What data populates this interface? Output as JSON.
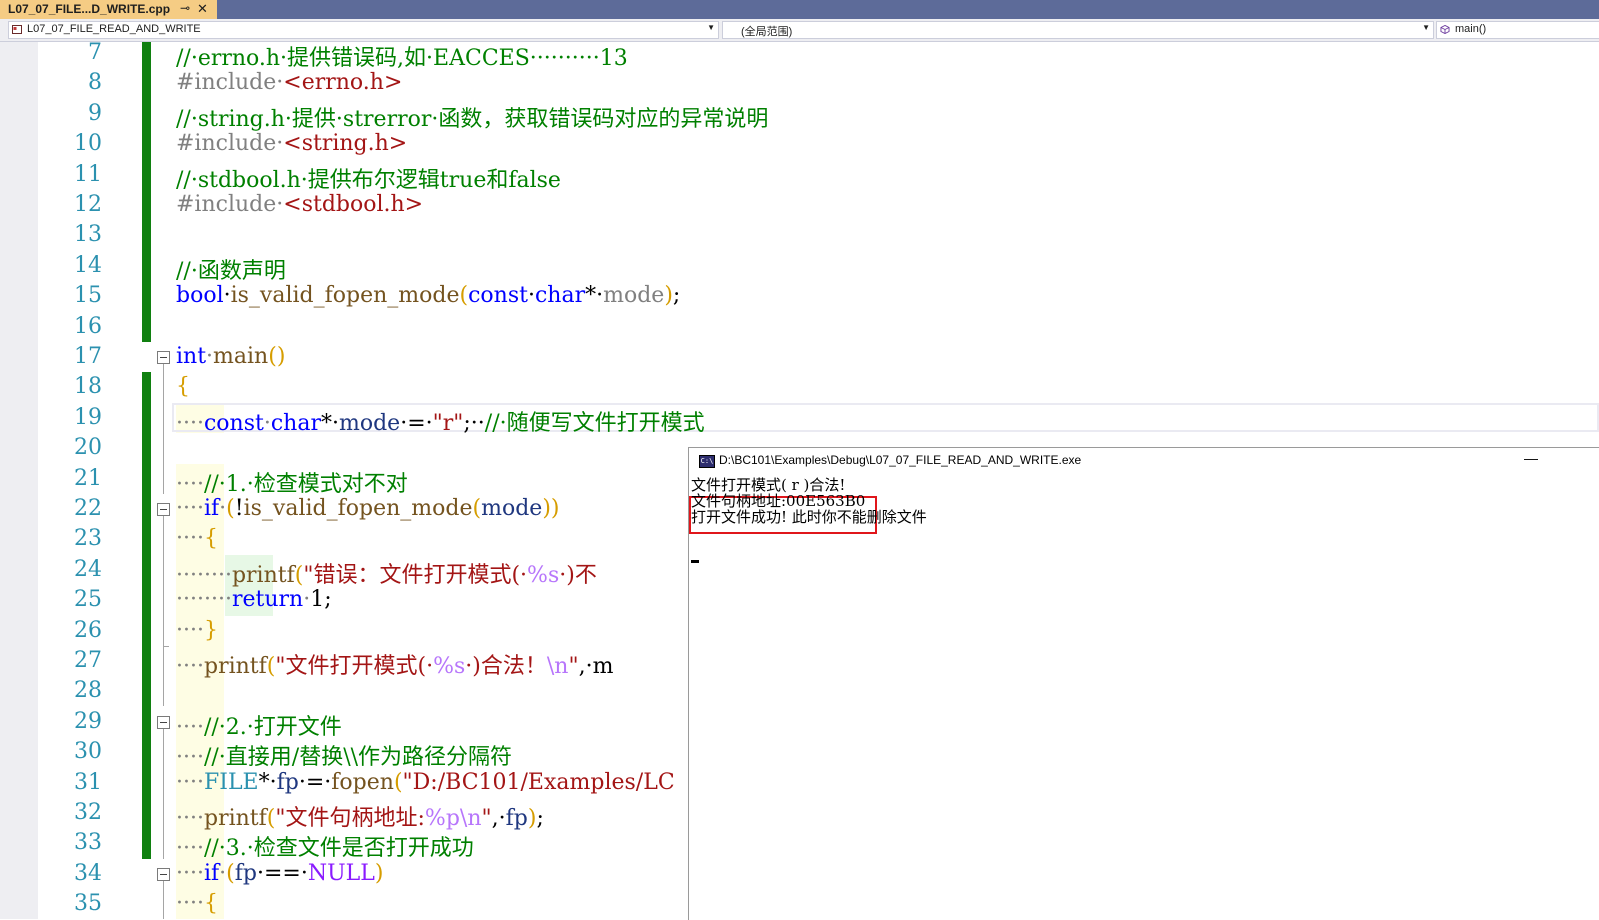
{
  "tab": {
    "title": "L07_07_FILE...D_WRITE.cpp",
    "pin_glyph": "⊸",
    "close_glyph": "✕"
  },
  "navbar": {
    "project": "L07_07_FILE_READ_AND_WRITE",
    "scope": "(全局范围)",
    "member": "main()"
  },
  "editor": {
    "line_numbers": [
      "7",
      "8",
      "9",
      "10",
      "11",
      "12",
      "13",
      "14",
      "15",
      "16",
      "17",
      "18",
      "19",
      "20",
      "21",
      "22",
      "23",
      "24",
      "25",
      "26",
      "27",
      "28",
      "29",
      "30",
      "31",
      "32",
      "33",
      "34",
      "35"
    ],
    "code": {
      "l7": "//·errno.h·提供错误码,如·EACCES··········13",
      "l8_pre": "#include·",
      "l8_inc": "<errno.h>",
      "l9": "//·string.h·提供·strerror·函数，获取错误码对应的异常说明",
      "l10_pre": "#include·",
      "l10_inc": "<string.h>",
      "l11": "//·stdbool.h·提供布尔逻辑true和false",
      "l12_pre": "#include·",
      "l12_inc": "<stdbool.h>",
      "l14": "//·函数声明",
      "l15_kw": "bool",
      "l15_fn": "is_valid_fopen_mode",
      "l15_p1": "(",
      "l15_kw2": "const",
      "l15_kw3": "char",
      "l15_var": "mode",
      "l15_p2": ")",
      "l15_end": ";",
      "l17_kw": "int",
      "l17_fn": "main",
      "l17_paren": "()",
      "l18": "{",
      "l19_ws": "····",
      "l19_kw": "const",
      "l19_kw2": "char",
      "l19_var": "mode",
      "l19_str": "\"r\"",
      "l19_cmt": "//·随便写文件打开模式",
      "l21_ws": "····",
      "l21_cmt": "//·1.·检查模式对不对",
      "l22_ws": "····",
      "l22_kw": "if",
      "l22_fn": "is_valid_fopen_mode",
      "l22_var": "mode",
      "l23_ws": "····",
      "l23": "{",
      "l24_ws": "········",
      "l24_fn": "printf",
      "l24_str1": "\"错误：文件打开模式(·",
      "l24_esc": "%s",
      "l24_str2": "·)不",
      "l25_ws": "········",
      "l25_kw": "return",
      "l25_num": "1",
      "l26_ws": "····",
      "l26": "}",
      "l27_ws": "····",
      "l27_fn": "printf",
      "l27_str1": "\"文件打开模式(·",
      "l27_esc": "%s",
      "l27_str2": "·)合法！",
      "l27_esc2": "\\n",
      "l27_str3": "\"",
      "l27_tail": ",·m",
      "l29_ws": "····",
      "l29_cmt": "//·2.·打开文件",
      "l30_ws": "····",
      "l30_cmt": "//·直接用/替换\\\\作为路径分隔符",
      "l31_ws": "····",
      "l31_type": "FILE",
      "l31_var": "fp",
      "l31_fn": "fopen",
      "l31_str": "\"D:/BC101/Examples/LC",
      "l32_ws": "····",
      "l32_fn": "printf",
      "l32_str1": "\"文件句柄地址:",
      "l32_esc": "%p\\n",
      "l32_str2": "\"",
      "l32_var": "fp",
      "l33_ws": "····",
      "l33_cmt": "//·3.·检查文件是否打开成功",
      "l34_ws": "····",
      "l34_kw": "if",
      "l34_var": "fp",
      "l34_macro": "NULL"
    }
  },
  "console": {
    "title": "D:\\BC101\\Examples\\Debug\\L07_07_FILE_READ_AND_WRITE.exe",
    "icon_text": "C:\\",
    "minimize_glyph": "—",
    "lines": [
      "文件打开模式( r )合法!",
      "文件句柄地址:00E563B0",
      "打开文件成功! 此时你不能删除文件"
    ]
  },
  "colors": {
    "tab_active": "#f5cc84",
    "tab_strip": "#5d6b99",
    "line_number": "#2b91af",
    "change_bar": "#108010",
    "comment": "#008000",
    "keyword": "#0000ff",
    "string": "#a31515",
    "highlight_box": "#e0161b"
  }
}
